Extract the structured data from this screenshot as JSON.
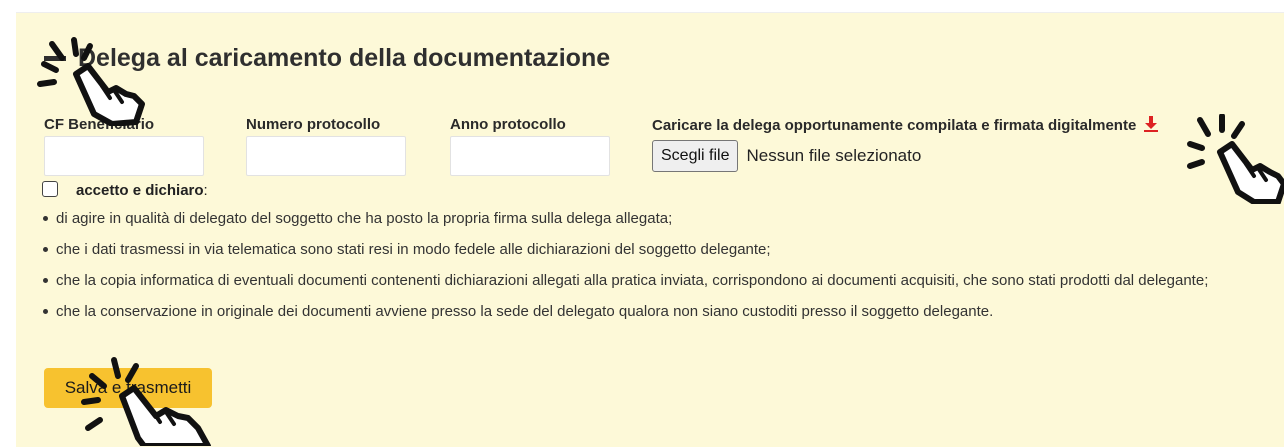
{
  "form": {
    "title": "Delega al caricamento della documentazione",
    "fields": {
      "cf_beneficiario_label": "CF Beneficiario",
      "numero_protocollo_label": "Numero protocollo",
      "anno_protocollo_label": "Anno protocollo",
      "upload_label": "Caricare la delega opportunamente compilata e firmata digitalmente",
      "file_button_label": "Scegli file",
      "file_status": "Nessun file selezionato"
    },
    "accept": {
      "label_bold": "accetto e dichiaro",
      "label_suffix": ":"
    },
    "declarations": [
      "di agire in qualità di delegato del soggetto che ha posto la propria firma sulla delega allegata;",
      "che i dati trasmessi in via telematica sono stati resi in modo fedele alle dichiarazioni del soggetto delegante;",
      "che la copia informatica di eventuali documenti contenenti dichiarazioni allegati alla pratica inviata, corrispondono ai documenti acquisiti, che sono stati prodotti dal delegante;",
      "che la conservazione in originale dei documenti avviene presso la sede del delegato qualora non siano custoditi presso il soggetto delegante."
    ],
    "submit_label": "Salva e trasmetti"
  },
  "icons": {
    "collapse": "minus-icon",
    "download": "download-icon",
    "pointer": "hand-pointer-icon"
  },
  "colors": {
    "panel_background": "#fdf9d8",
    "submit_button": "#f7c22f",
    "download_icon": "#d22222"
  }
}
